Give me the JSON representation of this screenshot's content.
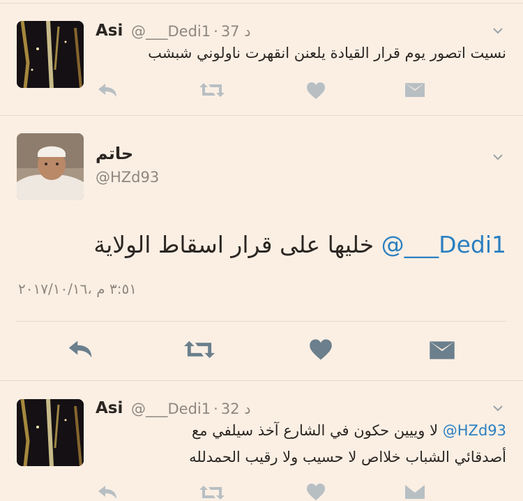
{
  "colors": {
    "background": "#fbefe4",
    "text": "#2b2622",
    "secondary": "#8f877f",
    "link": "#2b7fc0",
    "action_icon": "#b8bfc3",
    "action_icon_focused": "#6b7f8c"
  },
  "tweets": [
    {
      "name": "Asi",
      "handle": "@___Dedi1",
      "separator": "·",
      "time": "37 د",
      "text": "نسيت اتصور يوم قرار القيادة يلعنن انقهرت ناولوني شبشب",
      "avatar_icon": "sparkler-photo"
    },
    {
      "name": "حاتم",
      "handle": "@HZd93",
      "mention": "@___Dedi1",
      "text": "خليها على قرار اسقاط الولاية",
      "timestamp": "٣:٥١ م ،٢٠١٧/١٠/١٦",
      "avatar_icon": "child-photo"
    },
    {
      "name": "Asi",
      "handle": "@___Dedi1",
      "separator": "·",
      "time": "32 د",
      "mention": "@HZd93",
      "text_line1": "لا وييين حكون في الشارع آخذ سيلفي مع",
      "text_line2": "أصدقائي الشباب خلااص لا حسيب ولا رقيب الحمدلله",
      "avatar_icon": "sparkler-photo"
    }
  ]
}
